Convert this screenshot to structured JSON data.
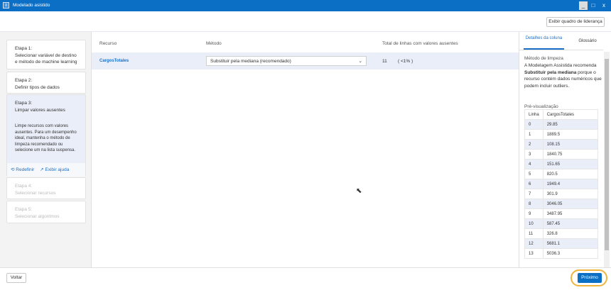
{
  "window": {
    "title": "Modelado asistido",
    "min": "_",
    "max": "□",
    "close": "x"
  },
  "header": {
    "leaderboard_button": "Exibir quadro de liderança"
  },
  "steps": [
    {
      "num": "Etapa 1:",
      "title": "Selecionar variável de destino e método de machine learning"
    },
    {
      "num": "Etapa 2:",
      "title": "Definir tipos de dados"
    },
    {
      "num": "Etapa 3:",
      "title": "Limpar valores ausentes",
      "desc": "Limpe recursos com valores ausentes. Para um desempenho ideal, mantenha o método de limpeza recomendado ou selecione um na lista suspensa.",
      "reset": "Redefinir",
      "help": "Exibir ajuda"
    },
    {
      "num": "Etapa 4:",
      "title": "Selecionar recursos"
    },
    {
      "num": "Etapa 5:",
      "title": "Selecionar algoritmos"
    }
  ],
  "main": {
    "columns": [
      "Recurso",
      "Método",
      "Total de linhas com valores ausentes"
    ],
    "rows": [
      {
        "feature": "CargosTotales",
        "method": "Substituir pela mediana (recomendado)",
        "count": "11",
        "pct": "( <1% )"
      }
    ]
  },
  "right": {
    "tabs": [
      "Detalhes da coluna",
      "Glossário"
    ],
    "section": "Método de limpeza",
    "text_pre": "A Modelagem Assistida recomenda ",
    "text_bold": "Substituir pela mediana",
    "text_post": " porque o recurso contém dados numéricos que podem incluir outliers.",
    "preview_label": "Pré-visualização",
    "preview_cols": [
      "Linha",
      "CargosTotales"
    ],
    "preview_rows": [
      [
        "0",
        "29.85"
      ],
      [
        "1",
        "1889.5"
      ],
      [
        "2",
        "108.15"
      ],
      [
        "3",
        "1840.75"
      ],
      [
        "4",
        "151.65"
      ],
      [
        "5",
        "820.5"
      ],
      [
        "6",
        "1949.4"
      ],
      [
        "7",
        "301.9"
      ],
      [
        "8",
        "3046.05"
      ],
      [
        "9",
        "3487.95"
      ],
      [
        "10",
        "587.45"
      ],
      [
        "11",
        "326.8"
      ],
      [
        "12",
        "5681.1"
      ],
      [
        "13",
        "5036.3"
      ]
    ]
  },
  "footer": {
    "back": "Voltar",
    "next": "Próximo"
  }
}
